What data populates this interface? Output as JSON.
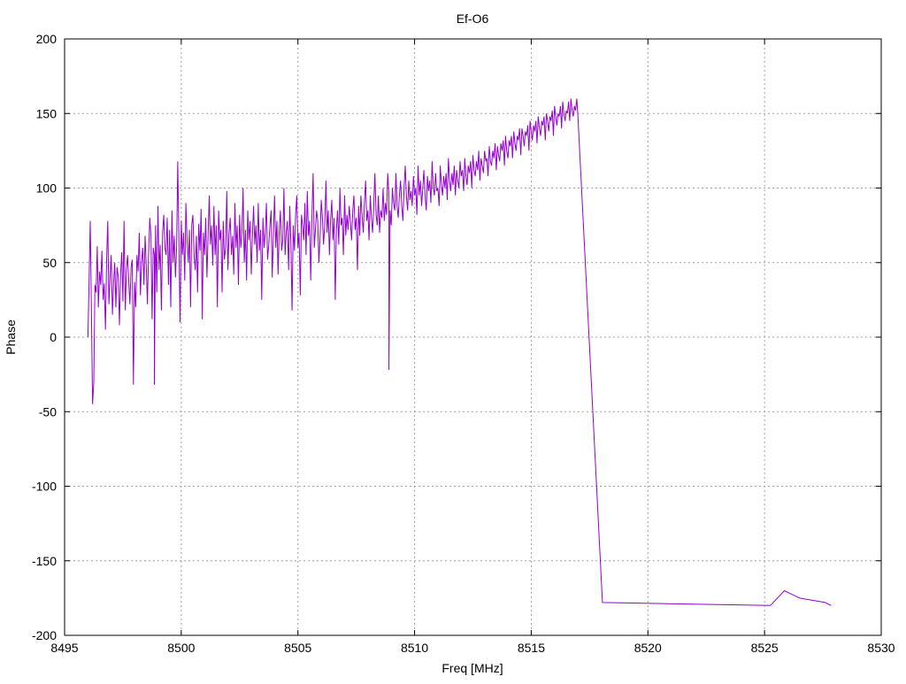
{
  "colors": {
    "series": "#9400d3",
    "axis": "#000000",
    "grid": "#a0a0a0",
    "background": "#ffffff"
  },
  "chart_data": {
    "type": "line",
    "title": "Ef-O6",
    "xlabel": "Freq [MHz]",
    "ylabel": "Phase",
    "xlim": [
      8495,
      8530
    ],
    "ylim": [
      -200,
      200
    ],
    "xticks": [
      8495,
      8500,
      8505,
      8510,
      8515,
      8520,
      8525,
      8530
    ],
    "yticks": [
      -200,
      -150,
      -100,
      -50,
      0,
      50,
      100,
      150,
      200
    ],
    "grid": true,
    "legend": "none",
    "series": [
      {
        "x_start": 8496.0,
        "x_step": 0.05,
        "values": [
          0,
          38,
          78,
          20,
          -45,
          -30,
          35,
          30,
          61,
          20,
          44,
          35,
          58,
          25,
          36,
          5,
          52,
          78,
          22,
          40,
          55,
          15,
          36,
          50,
          20,
          47,
          40,
          8,
          42,
          57,
          24,
          78,
          18,
          45,
          55,
          38,
          22,
          47,
          52,
          -32,
          37,
          20,
          55,
          44,
          70,
          28,
          50,
          60,
          35,
          68,
          48,
          22,
          55,
          80,
          68,
          12,
          60,
          55,
          75,
          30,
          88,
          45,
          62,
          18,
          70,
          82,
          60,
          55,
          80,
          35,
          72,
          20,
          85,
          50,
          68,
          40,
          60,
          118,
          65,
          10,
          78,
          55,
          70,
          38,
          90,
          65,
          50,
          72,
          20,
          75,
          82,
          55,
          45,
          68,
          30,
          76,
          58,
          86,
          12,
          70,
          55,
          80,
          40,
          68,
          95,
          62,
          75,
          48,
          88,
          55,
          75,
          20,
          85,
          65,
          72,
          30,
          78,
          52,
          60,
          98,
          45,
          70,
          80,
          55,
          68,
          42,
          90,
          60,
          75,
          35,
          82,
          60,
          70,
          100,
          50,
          72,
          38,
          85,
          65,
          78,
          42,
          68,
          88,
          62,
          75,
          50,
          90,
          58,
          72,
          25,
          80,
          60,
          70,
          90,
          52,
          62,
          75,
          85,
          40,
          68,
          95,
          60,
          78,
          42,
          72,
          85,
          58,
          65,
          100,
          55,
          70,
          78,
          45,
          88,
          62,
          18,
          75,
          58,
          82,
          95,
          60,
          70,
          28,
          82,
          75,
          65,
          90,
          55,
          98,
          68,
          78,
          38,
          80,
          110,
          60,
          72,
          85,
          78,
          50,
          68,
          92,
          80,
          62,
          75,
          105,
          70,
          85,
          55,
          78,
          92,
          65,
          80,
          25,
          72,
          85,
          62,
          100,
          75,
          80,
          55,
          95,
          68,
          82,
          72,
          88,
          78,
          65,
          85,
          95,
          72,
          80,
          45,
          88,
          68,
          95,
          82,
          70,
          90,
          105,
          78,
          85,
          65,
          95,
          80,
          70,
          88,
          110,
          82,
          75,
          95,
          70,
          85,
          80,
          100,
          78,
          90,
          82,
          110,
          95,
          85,
          75,
          100,
          90,
          85,
          110,
          88,
          80,
          95,
          105,
          88,
          78,
          100,
          115,
          95,
          85,
          105,
          92,
          98,
          88,
          108,
          95,
          100,
          82,
          115,
          95,
          105,
          88,
          100,
          112,
          95,
          85,
          108,
          98,
          105,
          90,
          118,
          100,
          95,
          110,
          98,
          100,
          88,
          115,
          102,
          95,
          108,
          100,
          110,
          92,
          120,
          105,
          98,
          110,
          102,
          115,
          95,
          112,
          105,
          100,
          118,
          108,
          112,
          98,
          120,
          108,
          102,
          115,
          110,
          118,
          100,
          122,
          112,
          108,
          118,
          112,
          125,
          105,
          120,
          115,
          110,
          125,
          118,
          120,
          108,
          128,
          118,
          115,
          125,
          120,
          130,
          112,
          128,
          122,
          118,
          130,
          125,
          132,
          115,
          135,
          125,
          120,
          132,
          128,
          135,
          120,
          138,
          130,
          125,
          135,
          132,
          140,
          122,
          140,
          135,
          128,
          138,
          135,
          142,
          125,
          145,
          138,
          132,
          142,
          138,
          145,
          130,
          148,
          140,
          135,
          145,
          142,
          148,
          132,
          150,
          145,
          138,
          148,
          145,
          152,
          135,
          155,
          148,
          142,
          150,
          148,
          155,
          140,
          158,
          150,
          145,
          152,
          150,
          158,
          145,
          160,
          152,
          148,
          155,
          152,
          160,
          148
        ]
      }
    ],
    "spikes": [
      {
        "x": 8498.85,
        "y": -32
      },
      {
        "x": 8508.9,
        "y": -22
      },
      {
        "x": 8518.05,
        "y": -178
      },
      {
        "x": 8525.25,
        "y": -180
      },
      {
        "x": 8525.85,
        "y": -170
      },
      {
        "x": 8526.5,
        "y": -175
      },
      {
        "x": 8527.6,
        "y": -178
      },
      {
        "x": 8527.85,
        "y": -180
      }
    ]
  }
}
